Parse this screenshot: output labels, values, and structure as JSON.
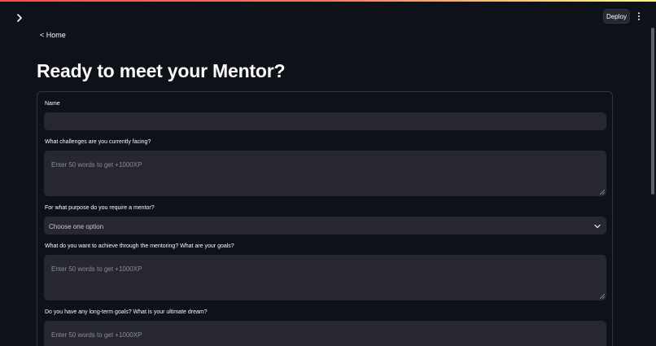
{
  "header": {
    "deploy_label": "Deploy",
    "icons": {
      "sidebar_toggle": "chevron-right-icon",
      "menu": "more-vertical-icon"
    }
  },
  "nav": {
    "home_link": "< Home"
  },
  "page": {
    "title": "Ready to meet your Mentor?"
  },
  "form": {
    "fields": [
      {
        "label": "Name",
        "type": "text",
        "value": "",
        "placeholder": ""
      },
      {
        "label": "What challenges are you currently facing?",
        "type": "textarea",
        "placeholder": "Enter 50 words to get +1000XP"
      },
      {
        "label": "For what purpose do you require a mentor?",
        "type": "select",
        "selected": "Choose one option"
      },
      {
        "label": "What do you want to achieve through the mentoring? What are your goals?",
        "type": "textarea",
        "placeholder": "Enter 50 words to get +1000XP"
      },
      {
        "label": "Do you have any long-term goals? What is your ultimate dream?",
        "type": "textarea",
        "placeholder": "Enter 50 words to get +1000XP"
      }
    ]
  },
  "colors": {
    "background": "#0e1117",
    "input_bg": "#262730",
    "border": "#31333f",
    "text": "#fafafa",
    "placeholder": "#8b8d97",
    "accent_red": "#ff4b4b",
    "accent_yellow": "#fffd80"
  }
}
